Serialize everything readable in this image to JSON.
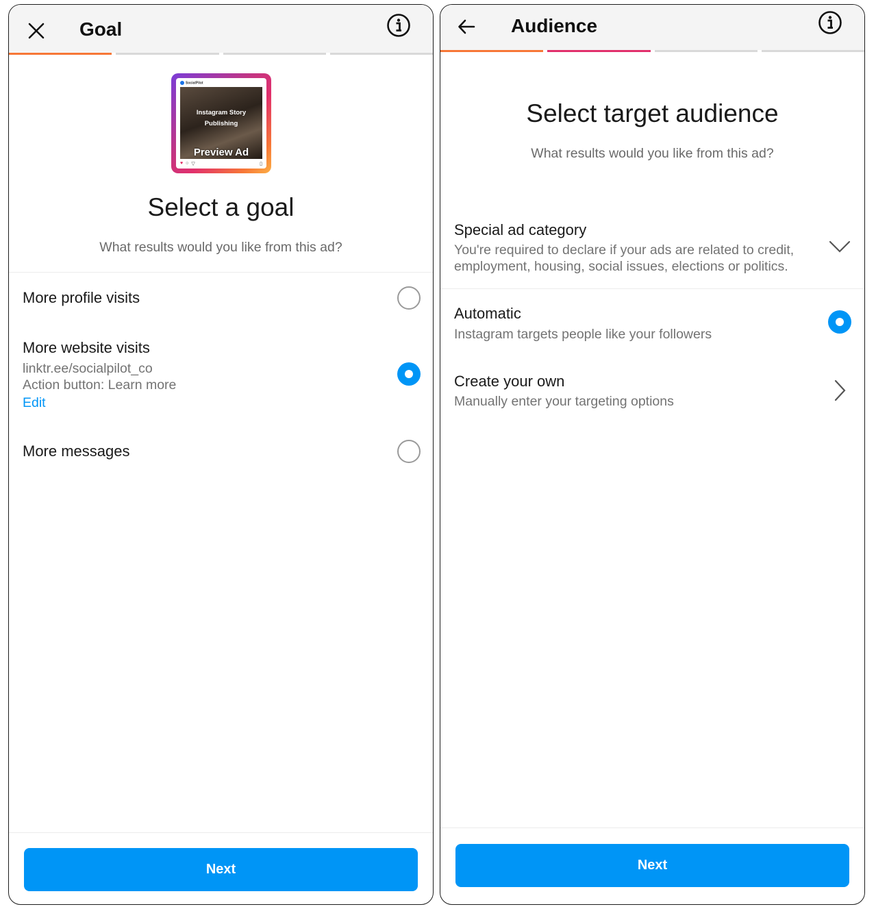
{
  "goal_screen": {
    "header": {
      "title": "Goal"
    },
    "progress": [
      "#f77737",
      "#d9d9d9",
      "#d9d9d9",
      "#d9d9d9"
    ],
    "thumbnail": {
      "brand": "SocialPilot",
      "line1": "Instagram Story",
      "line2": "Publishing",
      "preview_label": "Preview Ad"
    },
    "title": "Select a goal",
    "subtitle": "What results would you like from this ad?",
    "options": [
      {
        "label": "More profile visits",
        "selected": false
      },
      {
        "label": "More website visits",
        "url": "linktr.ee/socialpilot_co",
        "action": "Action button: Learn more",
        "edit": "Edit",
        "selected": true
      },
      {
        "label": "More messages",
        "selected": false
      }
    ],
    "next_label": "Next"
  },
  "audience_screen": {
    "header": {
      "title": "Audience"
    },
    "progress": [
      "#f77737",
      "#e1306c",
      "#d9d9d9",
      "#d9d9d9"
    ],
    "title": "Select target audience",
    "subtitle": "What results would you like from this ad?",
    "special": {
      "label": "Special ad category",
      "desc_line1": "You're required to declare if your ads are related to credit,",
      "desc_line2": "employment, housing, social issues, elections or politics."
    },
    "automatic": {
      "label": "Automatic",
      "desc": "Instagram targets people like your followers",
      "selected": true
    },
    "create_own": {
      "label": "Create your own",
      "desc": "Manually enter your targeting options"
    },
    "next_label": "Next"
  },
  "colors": {
    "accent": "#0095f6",
    "orange": "#f77737",
    "pink": "#e1306c"
  }
}
